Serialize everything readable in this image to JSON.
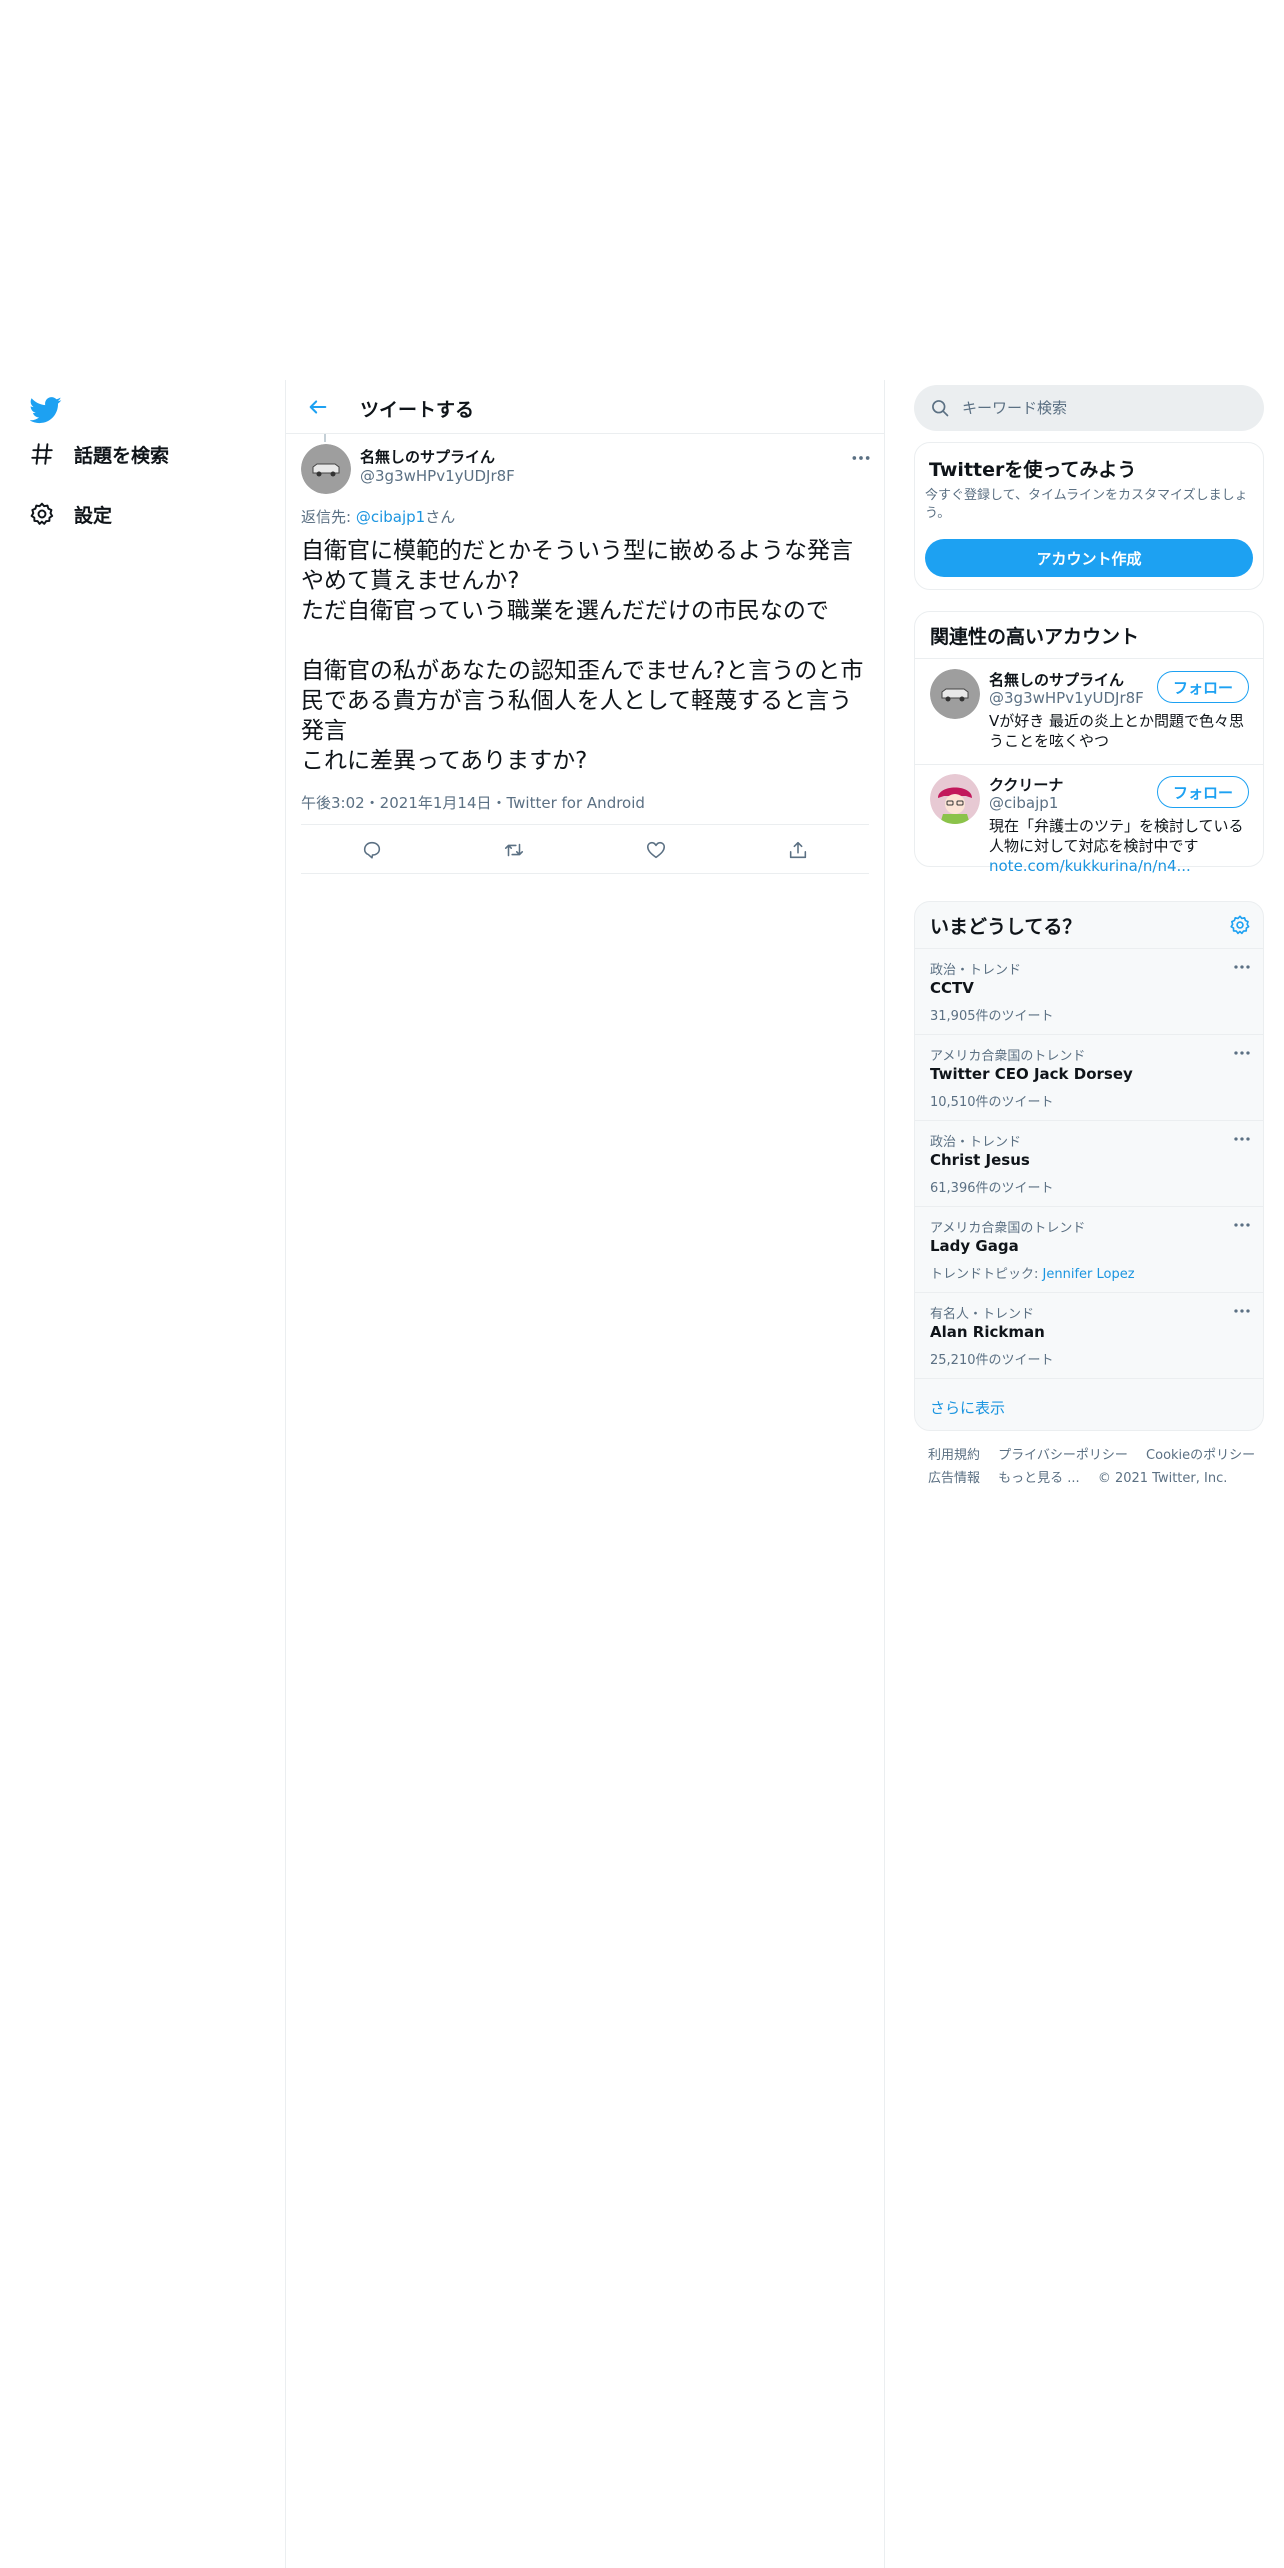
{
  "nav": {
    "items": [
      {
        "label": "話題を検索",
        "icon": "hashtag-icon"
      },
      {
        "label": "設定",
        "icon": "gear-icon"
      }
    ]
  },
  "header": {
    "title": "ツイートする"
  },
  "tweet": {
    "author_name": "名無しのサプライん",
    "author_handle": "@3g3wHPv1yUDJr8F",
    "reply_prefix": "返信先: ",
    "reply_user": "@cibajp1",
    "reply_suffix": "さん",
    "text": "自衛官に模範的だとかそういう型に嵌めるような発言やめて貰えませんか?\nただ自衛官っていう職業を選んだだけの市民なので\n\n自衛官の私があなたの認知歪んでません?と言うのと市民である貴方が言う私個人を人として軽蔑すると言う発言\nこれに差異ってありますか?",
    "meta": "午後3:02・2021年1月14日・Twitter for Android"
  },
  "search": {
    "placeholder": "キーワード検索"
  },
  "signup": {
    "title": "Twitterを使ってみよう",
    "description": "今すぐ登録して、タイムラインをカスタマイズしましょう。",
    "button": "アカウント作成"
  },
  "related": {
    "title": "関連性の高いアカウント",
    "accounts": [
      {
        "name": "名無しのサプライん",
        "handle": "@3g3wHPv1yUDJr8F",
        "bio": "Vが好き 最近の炎上とか問題で色々思うことを呟くやつ",
        "bio_link": "",
        "follow": "フォロー"
      },
      {
        "name": "ククリーナ",
        "handle": "@cibajp1",
        "bio": "現在「弁護士のツテ」を検討している人物に対して対応を検討中です",
        "bio_link": "note.com/kukkurina/n/n4...",
        "follow": "フォロー"
      }
    ]
  },
  "trends": {
    "title": "いまどうしてる？",
    "items": [
      {
        "category": "政治・トレンド",
        "name": "CCTV",
        "count": "31,905件のツイート",
        "topic_prefix": "",
        "topic_link": ""
      },
      {
        "category": "アメリカ合衆国のトレンド",
        "name": "Twitter CEO Jack Dorsey",
        "count": "10,510件のツイート",
        "topic_prefix": "",
        "topic_link": ""
      },
      {
        "category": "政治・トレンド",
        "name": "Christ Jesus",
        "count": "61,396件のツイート",
        "topic_prefix": "",
        "topic_link": ""
      },
      {
        "category": "アメリカ合衆国のトレンド",
        "name": "Lady Gaga",
        "count": "",
        "topic_prefix": "トレンドトピック: ",
        "topic_link": "Jennifer Lopez"
      },
      {
        "category": "有名人・トレンド",
        "name": "Alan Rickman",
        "count": "25,210件のツイート",
        "topic_prefix": "",
        "topic_link": ""
      }
    ],
    "show_more": "さらに表示"
  },
  "footer": {
    "terms": "利用規約",
    "privacy": "プライバシーポリシー",
    "cookie": "Cookieのポリシー",
    "ads": "広告情報",
    "more": "もっと見る ...",
    "copyright": "© 2021 Twitter, Inc."
  },
  "colors": {
    "accent": "#1da1f2",
    "link": "#1b95e0",
    "secondary_text": "#5b7083",
    "border": "#ebeef0",
    "panel_bg": "#f7f9fa"
  }
}
